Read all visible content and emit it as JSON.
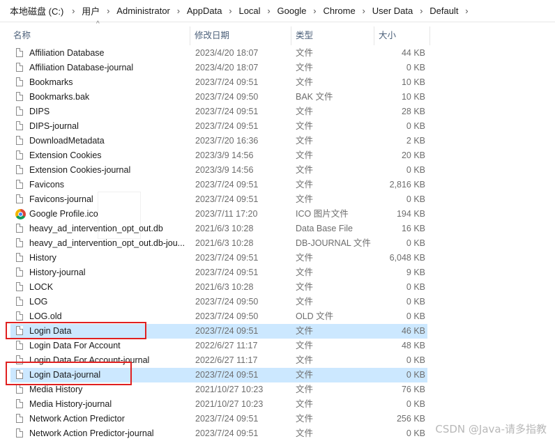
{
  "breadcrumb": [
    "本地磁盘 (C:)",
    "用户",
    "Administrator",
    "AppData",
    "Local",
    "Google",
    "Chrome",
    "User Data",
    "Default"
  ],
  "columns": {
    "name": "名称",
    "date": "修改日期",
    "type": "类型",
    "size": "大小"
  },
  "files": [
    {
      "name": "Affiliation Database",
      "date": "2023/4/20 18:07",
      "type": "文件",
      "size": "44 KB",
      "icon": "file-icon"
    },
    {
      "name": "Affiliation Database-journal",
      "date": "2023/4/20 18:07",
      "type": "文件",
      "size": "0 KB",
      "icon": "file-icon"
    },
    {
      "name": "Bookmarks",
      "date": "2023/7/24 09:51",
      "type": "文件",
      "size": "10 KB",
      "icon": "file-icon"
    },
    {
      "name": "Bookmarks.bak",
      "date": "2023/7/24 09:50",
      "type": "BAK 文件",
      "size": "10 KB",
      "icon": "file-icon"
    },
    {
      "name": "DIPS",
      "date": "2023/7/24 09:51",
      "type": "文件",
      "size": "28 KB",
      "icon": "file-icon"
    },
    {
      "name": "DIPS-journal",
      "date": "2023/7/24 09:51",
      "type": "文件",
      "size": "0 KB",
      "icon": "file-icon"
    },
    {
      "name": "DownloadMetadata",
      "date": "2023/7/20 16:36",
      "type": "文件",
      "size": "2 KB",
      "icon": "file-icon"
    },
    {
      "name": "Extension Cookies",
      "date": "2023/3/9 14:56",
      "type": "文件",
      "size": "20 KB",
      "icon": "file-icon"
    },
    {
      "name": "Extension Cookies-journal",
      "date": "2023/3/9 14:56",
      "type": "文件",
      "size": "0 KB",
      "icon": "file-icon"
    },
    {
      "name": "Favicons",
      "date": "2023/7/24 09:51",
      "type": "文件",
      "size": "2,816 KB",
      "icon": "file-icon"
    },
    {
      "name": "Favicons-journal",
      "date": "2023/7/24 09:51",
      "type": "文件",
      "size": "0 KB",
      "icon": "file-icon"
    },
    {
      "name": "Google Profile.ico",
      "date": "2023/7/11 17:20",
      "type": "ICO 图片文件",
      "size": "194 KB",
      "icon": "chrome-icon"
    },
    {
      "name": "heavy_ad_intervention_opt_out.db",
      "date": "2021/6/3 10:28",
      "type": "Data Base File",
      "size": "16 KB",
      "icon": "file-icon"
    },
    {
      "name": "heavy_ad_intervention_opt_out.db-jou...",
      "date": "2021/6/3 10:28",
      "type": "DB-JOURNAL 文件",
      "size": "0 KB",
      "icon": "file-icon"
    },
    {
      "name": "History",
      "date": "2023/7/24 09:51",
      "type": "文件",
      "size": "6,048 KB",
      "icon": "file-icon"
    },
    {
      "name": "History-journal",
      "date": "2023/7/24 09:51",
      "type": "文件",
      "size": "9 KB",
      "icon": "file-icon"
    },
    {
      "name": "LOCK",
      "date": "2021/6/3 10:28",
      "type": "文件",
      "size": "0 KB",
      "icon": "file-icon"
    },
    {
      "name": "LOG",
      "date": "2023/7/24 09:50",
      "type": "文件",
      "size": "0 KB",
      "icon": "file-icon"
    },
    {
      "name": "LOG.old",
      "date": "2023/7/24 09:50",
      "type": "OLD 文件",
      "size": "0 KB",
      "icon": "file-icon"
    },
    {
      "name": "Login Data",
      "date": "2023/7/24 09:51",
      "type": "文件",
      "size": "46 KB",
      "icon": "file-icon",
      "selected": true
    },
    {
      "name": "Login Data For Account",
      "date": "2022/6/27 11:17",
      "type": "文件",
      "size": "48 KB",
      "icon": "file-icon"
    },
    {
      "name": "Login Data For Account-journal",
      "date": "2022/6/27 11:17",
      "type": "文件",
      "size": "0 KB",
      "icon": "file-icon"
    },
    {
      "name": "Login Data-journal",
      "date": "2023/7/24 09:51",
      "type": "文件",
      "size": "0 KB",
      "icon": "file-icon",
      "selected": true
    },
    {
      "name": "Media History",
      "date": "2021/10/27 10:23",
      "type": "文件",
      "size": "76 KB",
      "icon": "file-icon"
    },
    {
      "name": "Media History-journal",
      "date": "2021/10/27 10:23",
      "type": "文件",
      "size": "0 KB",
      "icon": "file-icon"
    },
    {
      "name": "Network Action Predictor",
      "date": "2023/7/24 09:51",
      "type": "文件",
      "size": "256 KB",
      "icon": "file-icon"
    },
    {
      "name": "Network Action Predictor-journal",
      "date": "2023/7/24 09:51",
      "type": "文件",
      "size": "0 KB",
      "icon": "file-icon"
    }
  ],
  "watermark": "CSDN @Java-请多指教",
  "colors": {
    "selection": "#cce8ff",
    "highlight_border": "#e02020",
    "header_text": "#4c607a"
  }
}
